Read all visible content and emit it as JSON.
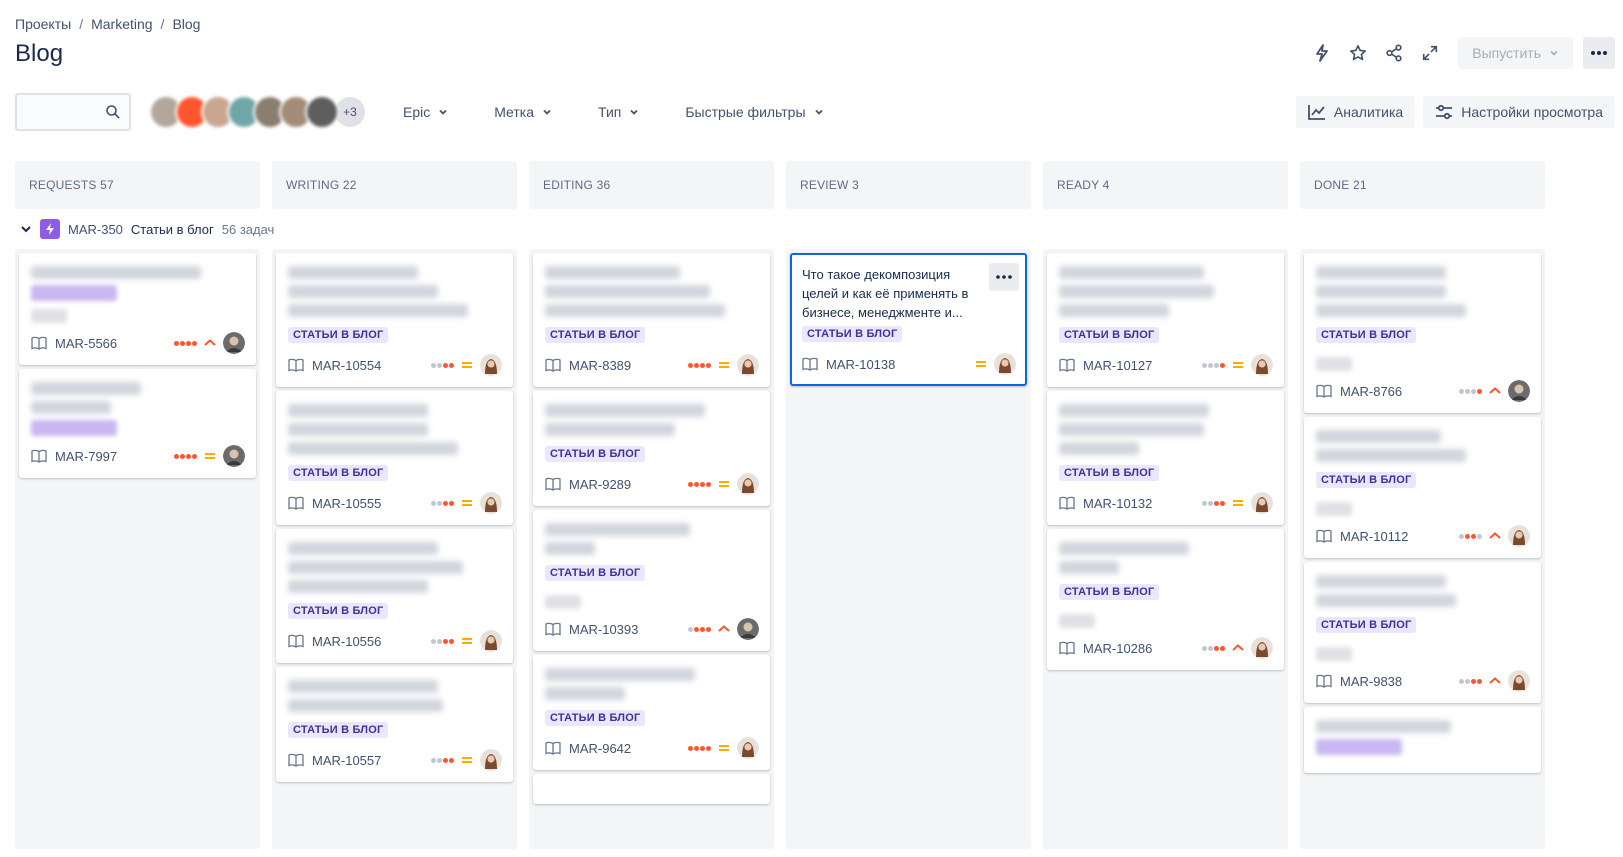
{
  "breadcrumb": [
    "Проекты",
    "Marketing",
    "Blog"
  ],
  "page_title": "Blog",
  "header": {
    "release_label": "Выпустить"
  },
  "toolbar": {
    "search_value": "",
    "avatars_more": "+3",
    "filters": [
      "Epic",
      "Метка",
      "Тип",
      "Быстрые фильтры"
    ],
    "analytics_label": "Аналитика",
    "view_settings_label": "Настройки просмотра"
  },
  "columns": [
    "REQUESTS 57",
    "WRITING 22",
    "EDITING 36",
    "REVIEW 3",
    "READY 4",
    "DONE 21"
  ],
  "swimlane": {
    "key": "MAR-350",
    "name": "Статьи в блог",
    "count": "56 задач"
  },
  "label_text": "СТАТЬИ В БЛОГ",
  "selected_card": {
    "title": "Что такое декомпозиция целей и как её применять в бизнесе, менеджменте и...",
    "key": "MAR-10138"
  },
  "cards": {
    "requests": [
      "MAR-5566",
      "MAR-7997"
    ],
    "writing": [
      "MAR-10554",
      "MAR-10555",
      "MAR-10556",
      "MAR-10557"
    ],
    "editing": [
      "MAR-8389",
      "MAR-9289",
      "MAR-10393",
      "MAR-9642"
    ],
    "ready": [
      "MAR-10127",
      "MAR-10132",
      "MAR-10286"
    ],
    "done": [
      "MAR-8766",
      "MAR-10112",
      "MAR-9838"
    ]
  },
  "colors": {
    "priority_red": "#ff5630",
    "priority_medium": "#ffab00",
    "epic": "#8f5ce8",
    "selected_border": "#0c66e4"
  }
}
